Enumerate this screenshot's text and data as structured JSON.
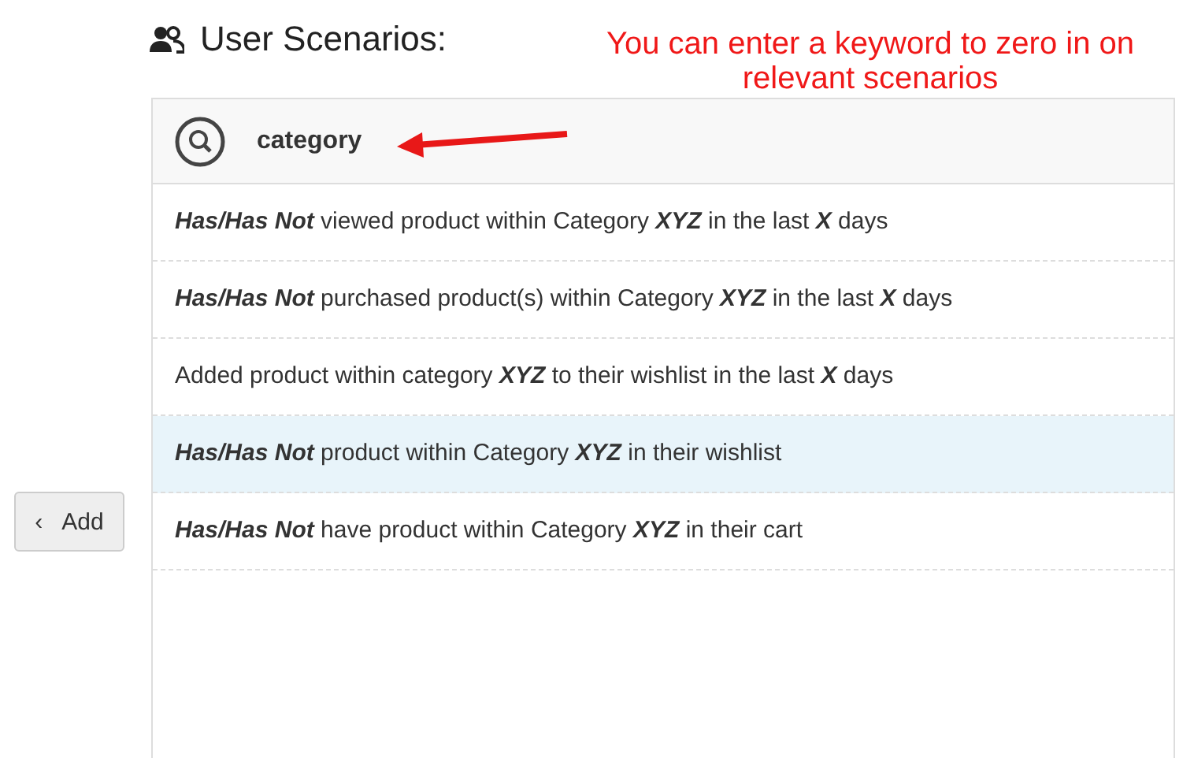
{
  "heading": {
    "title": "User Scenarios:"
  },
  "annotation": {
    "text": "You can enter a keyword to zero in on relevant scenarios"
  },
  "search": {
    "value": "category"
  },
  "scenarios": [
    {
      "text": "*Has/Has Not* viewed product within Category *XYZ* in the last *X* days",
      "selected": false
    },
    {
      "text": "*Has/Has Not* purchased product(s) within Category *XYZ* in the last *X* days",
      "selected": false
    },
    {
      "text": "Added product within category *XYZ* to their wishlist in the last *X* days",
      "selected": false
    },
    {
      "text": "*Has/Has Not* product within Category *XYZ* in their wishlist",
      "selected": true
    },
    {
      "text": "*Has/Has Not* have product within Category *XYZ* in their cart",
      "selected": false
    }
  ],
  "add_button": {
    "icon": "‹",
    "label": "Add"
  }
}
